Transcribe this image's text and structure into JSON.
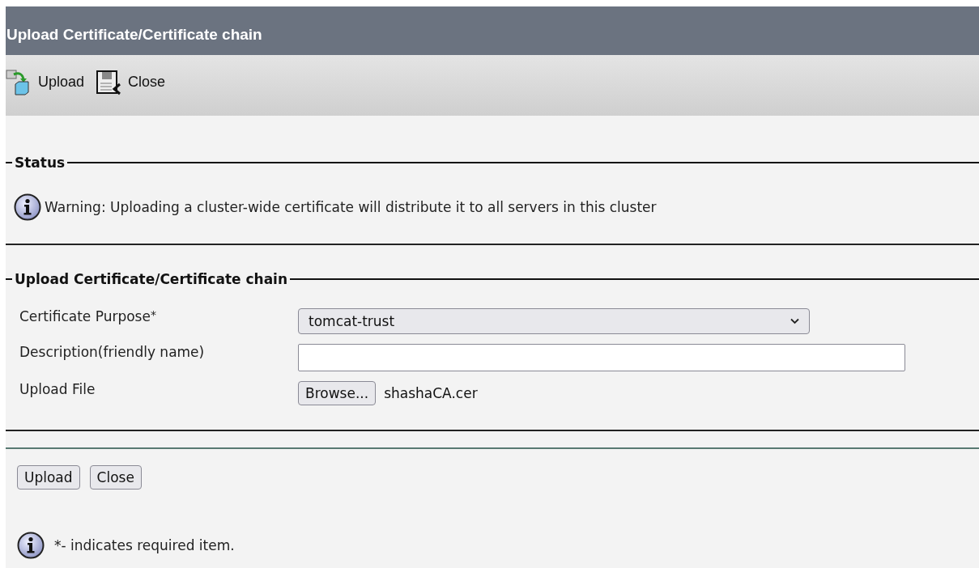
{
  "window": {
    "title": "Upload Certificate/Certificate chain"
  },
  "toolbar": [
    {
      "label": "Upload",
      "kind": "upload"
    },
    {
      "label": "Close",
      "kind": "close"
    }
  ],
  "status": {
    "legend": "Status",
    "message": "Warning: Uploading a cluster-wide certificate will distribute it to all servers in this cluster"
  },
  "form": {
    "legend": "Upload Certificate/Certificate chain",
    "fields": [
      {
        "kind": "select",
        "label": "Certificate Purpose",
        "required_mark": "*",
        "value": "tomcat-trust"
      },
      {
        "kind": "text",
        "label": "Description(friendly name)"
      },
      {
        "kind": "file",
        "label": "Upload File",
        "button": "Browse...",
        "file_name": "shashaCA.cer"
      }
    ]
  },
  "buttons": [
    "Upload",
    "Close"
  ],
  "note": "*- indicates required item."
}
